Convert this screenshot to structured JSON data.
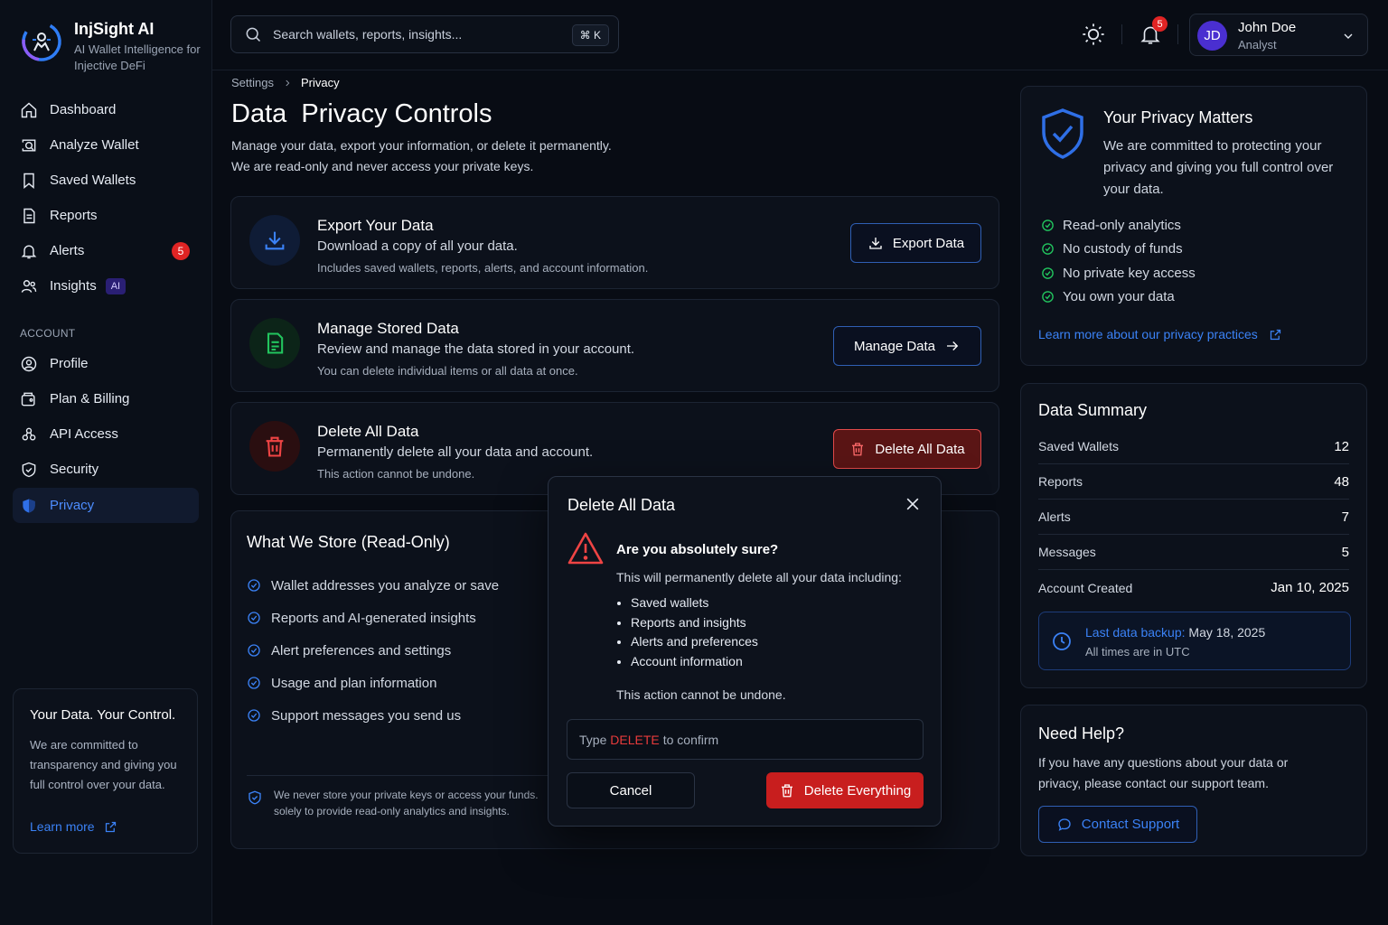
{
  "brand": {
    "name": "InjSight AI",
    "tagline": "AI Wallet Intelligence for Injective DeFi"
  },
  "nav": {
    "items": [
      {
        "label": "Dashboard",
        "icon": "home-icon"
      },
      {
        "label": "Analyze Wallet",
        "icon": "analyze-icon"
      },
      {
        "label": "Saved Wallets",
        "icon": "bookmark-icon"
      },
      {
        "label": "Reports",
        "icon": "document-icon"
      },
      {
        "label": "Alerts",
        "icon": "bell-icon",
        "badge": "5"
      },
      {
        "label": "Insights",
        "icon": "users-icon",
        "tag": "AI"
      }
    ],
    "account_heading": "ACCOUNT",
    "account_items": [
      {
        "label": "Profile",
        "icon": "user-circle-icon"
      },
      {
        "label": "Plan & Billing",
        "icon": "billing-icon"
      },
      {
        "label": "API Access",
        "icon": "api-icon"
      },
      {
        "label": "Security",
        "icon": "shield-icon"
      },
      {
        "label": "Privacy",
        "icon": "privacy-shield-icon",
        "active": true
      }
    ]
  },
  "sidebar_card": {
    "title": "Your Data. Your Control.",
    "text": "We are committed to transparency and giving you full control over your data.",
    "link": "Learn more"
  },
  "topbar": {
    "search_placeholder": "Search wallets, reports, insights...",
    "shortcut": "⌘ K",
    "notifications": "5",
    "user": {
      "initials": "JD",
      "name": "John Doe",
      "role": "Analyst"
    }
  },
  "breadcrumb": {
    "parent": "Settings",
    "current": "Privacy"
  },
  "page": {
    "title": "Data  Privacy Controls",
    "desc1": "Manage your data, export your information, or delete it permanently.",
    "desc2": "We are read-only and never access your private keys."
  },
  "actions": {
    "export": {
      "title": "Export Your Data",
      "sub": "Download a copy of all your data.",
      "note": "Includes saved wallets, reports, alerts, and account information.",
      "button": "Export Data"
    },
    "manage": {
      "title": "Manage Stored Data",
      "sub": "Review and manage the data stored in your account.",
      "note": "You can delete individual items or all data at once.",
      "button": "Manage Data"
    },
    "delete": {
      "title": "Delete All Data",
      "sub": "Permanently delete all your data and account.",
      "note": "This action cannot be undone.",
      "button": "Delete All Data"
    }
  },
  "store": {
    "title": "What We Store (Read-Only)",
    "items": [
      "Wallet addresses you analyze or save",
      "Reports and AI-generated insights",
      "Alert preferences and settings",
      "Usage and plan information",
      "Support messages you send us"
    ],
    "footer1": "We never store your private keys or access your funds.",
    "footer2": "solely to provide read-only analytics and insights."
  },
  "privacy_matters": {
    "title": "Your Privacy Matters",
    "desc": "We are committed to protecting your privacy and giving you full control over your data.",
    "items": [
      "Read-only analytics",
      "No custody of funds",
      "No private key access",
      "You own your data"
    ],
    "link": "Learn more about our privacy practices"
  },
  "data_summary": {
    "title": "Data Summary",
    "rows": [
      {
        "label": "Saved Wallets",
        "value": "12"
      },
      {
        "label": "Reports",
        "value": "48"
      },
      {
        "label": "Alerts",
        "value": "7"
      },
      {
        "label": "Messages",
        "value": "5"
      },
      {
        "label": "Account Created",
        "value": "Jan 10, 2025"
      }
    ],
    "backup_label": "Last data backup:",
    "backup_date": "May 18, 2025",
    "timezone_note": "All times are in UTC"
  },
  "help": {
    "title": "Need Help?",
    "desc": "If you have any questions about your data or privacy, please contact our support team.",
    "button": "Contact Support"
  },
  "modal": {
    "title": "Delete All Data",
    "question": "Are you absolutely sure?",
    "desc": "This will permanently delete all your data including:",
    "items": [
      "Saved wallets",
      "Reports and insights",
      "Alerts and preferences",
      "Account information"
    ],
    "undo": "This action cannot be undone.",
    "confirm_prefix": "Type",
    "confirm_word": "DELETE",
    "confirm_suffix": "to confirm",
    "cancel": "Cancel",
    "delete": "Delete Everything"
  },
  "colors": {
    "accent": "#3b82f6",
    "danger": "#e02424",
    "success": "#22c55e",
    "background": "#080c14"
  }
}
